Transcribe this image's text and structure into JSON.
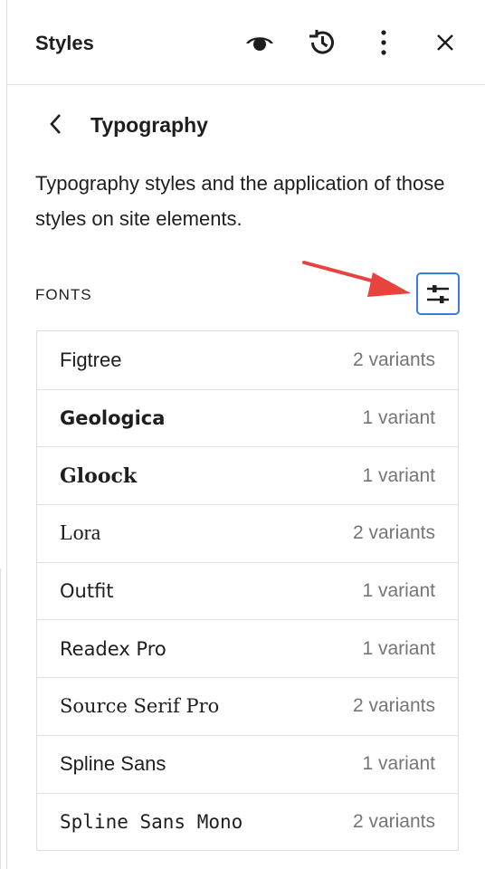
{
  "header": {
    "title": "Styles",
    "icons": {
      "preview": "eye-icon",
      "revisions": "revisions-icon",
      "more": "more-vertical-icon",
      "close": "close-icon"
    }
  },
  "nav": {
    "back_icon": "chevron-left-icon",
    "title": "Typography"
  },
  "description": "Typography styles and the application of those styles on site elements.",
  "fonts_section": {
    "heading": "FONTS",
    "manage_icon": "settings-sliders-icon",
    "accent_color": "#3b7dd8",
    "annotation_arrow_color": "#e8433f"
  },
  "fonts": [
    {
      "name": "Figtree",
      "variants": "2 variants"
    },
    {
      "name": "Geologica",
      "variants": "1 variant"
    },
    {
      "name": "Gloock",
      "variants": "1 variant"
    },
    {
      "name": "Lora",
      "variants": "2 variants"
    },
    {
      "name": "Outfit",
      "variants": "1 variant"
    },
    {
      "name": "Readex Pro",
      "variants": "1 variant"
    },
    {
      "name": "Source Serif Pro",
      "variants": "2 variants"
    },
    {
      "name": "Spline Sans",
      "variants": "1 variant"
    },
    {
      "name": "Spline Sans Mono",
      "variants": "2 variants"
    }
  ]
}
